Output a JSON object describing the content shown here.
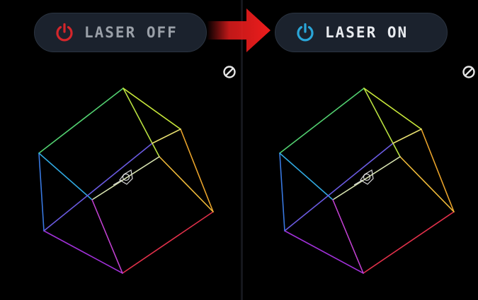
{
  "laser_off_button": {
    "label": "LASER OFF",
    "icon": "power-icon",
    "icon_color": "#d3262b"
  },
  "laser_on_button": {
    "label": "LASER ON",
    "icon": "power-icon",
    "icon_color": "#2aa6d8"
  },
  "transition_arrow": {
    "icon": "arrow-right-icon",
    "color": "#e21d1d"
  },
  "left_view": {
    "indicator_icon": "no-entry-icon",
    "cube_icon": "wireframe-cube-icon"
  },
  "right_view": {
    "indicator_icon": "no-entry-icon",
    "cube_icon": "wireframe-cube-icon"
  },
  "colors": {
    "background": "#000000",
    "button_bg": "#1b222d"
  }
}
